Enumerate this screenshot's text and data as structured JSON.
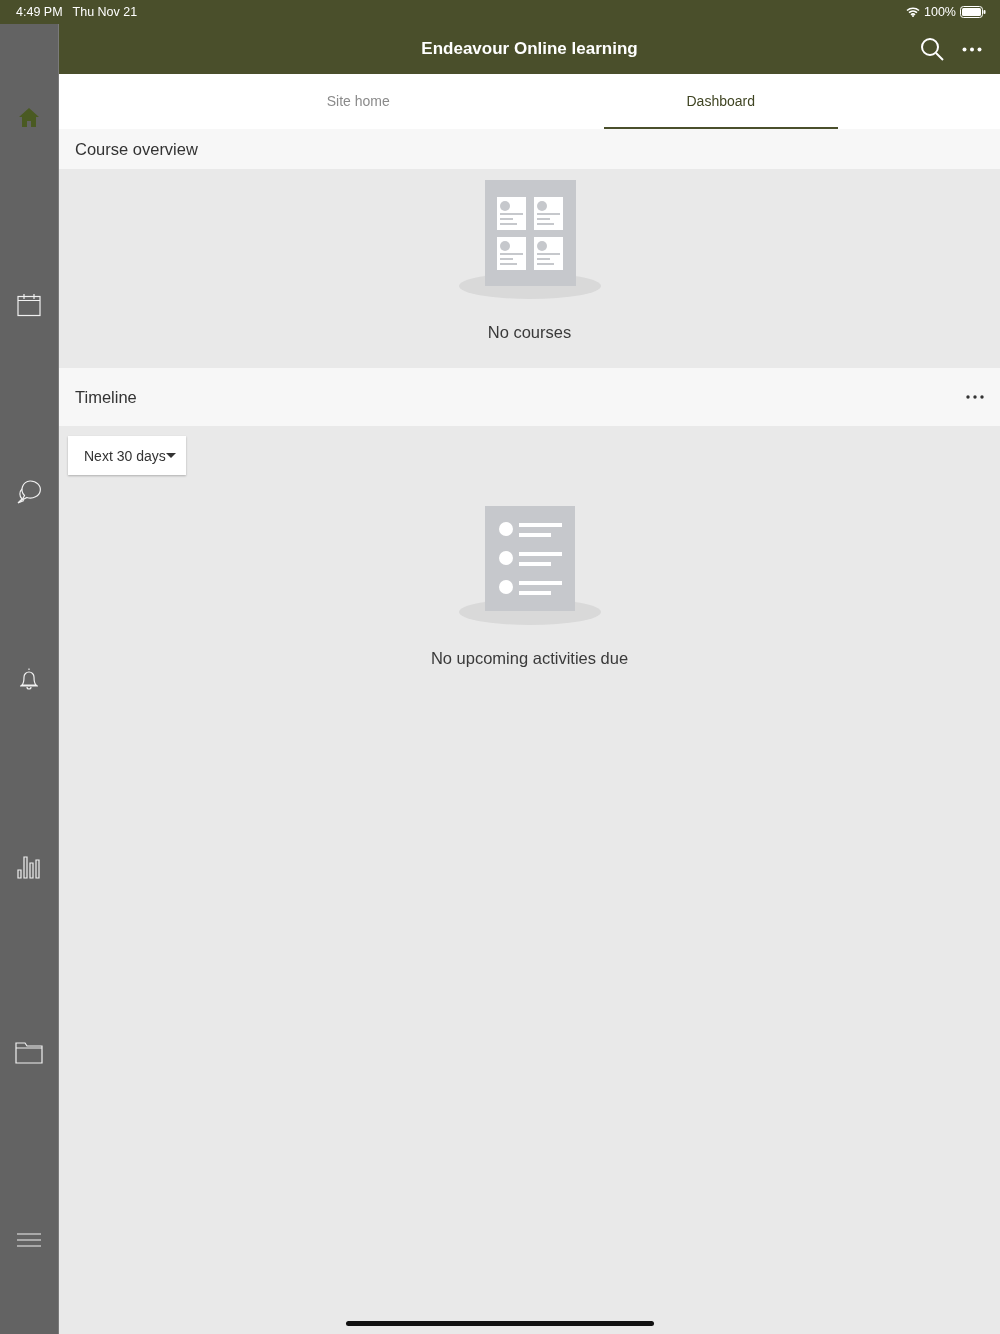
{
  "status_bar": {
    "time": "4:49 PM",
    "date": "Thu Nov 21",
    "battery": "100%"
  },
  "sidebar": {
    "items": [
      {
        "kind": "home",
        "selected": true
      },
      {
        "kind": "calendar",
        "selected": false
      },
      {
        "kind": "messages",
        "selected": false
      },
      {
        "kind": "notifications",
        "selected": false
      },
      {
        "kind": "grades",
        "selected": false
      },
      {
        "kind": "files",
        "selected": false
      },
      {
        "kind": "menu",
        "selected": false
      }
    ]
  },
  "header": {
    "title": "Endeavour Online learning"
  },
  "tabs": [
    {
      "label": "Site home",
      "selected": false
    },
    {
      "label": "Dashboard",
      "selected": true
    }
  ],
  "course_overview": {
    "title": "Course overview",
    "empty_text": "No courses"
  },
  "timeline": {
    "title": "Timeline",
    "filter": "Next 30 days",
    "empty_text": "No upcoming activities due"
  }
}
